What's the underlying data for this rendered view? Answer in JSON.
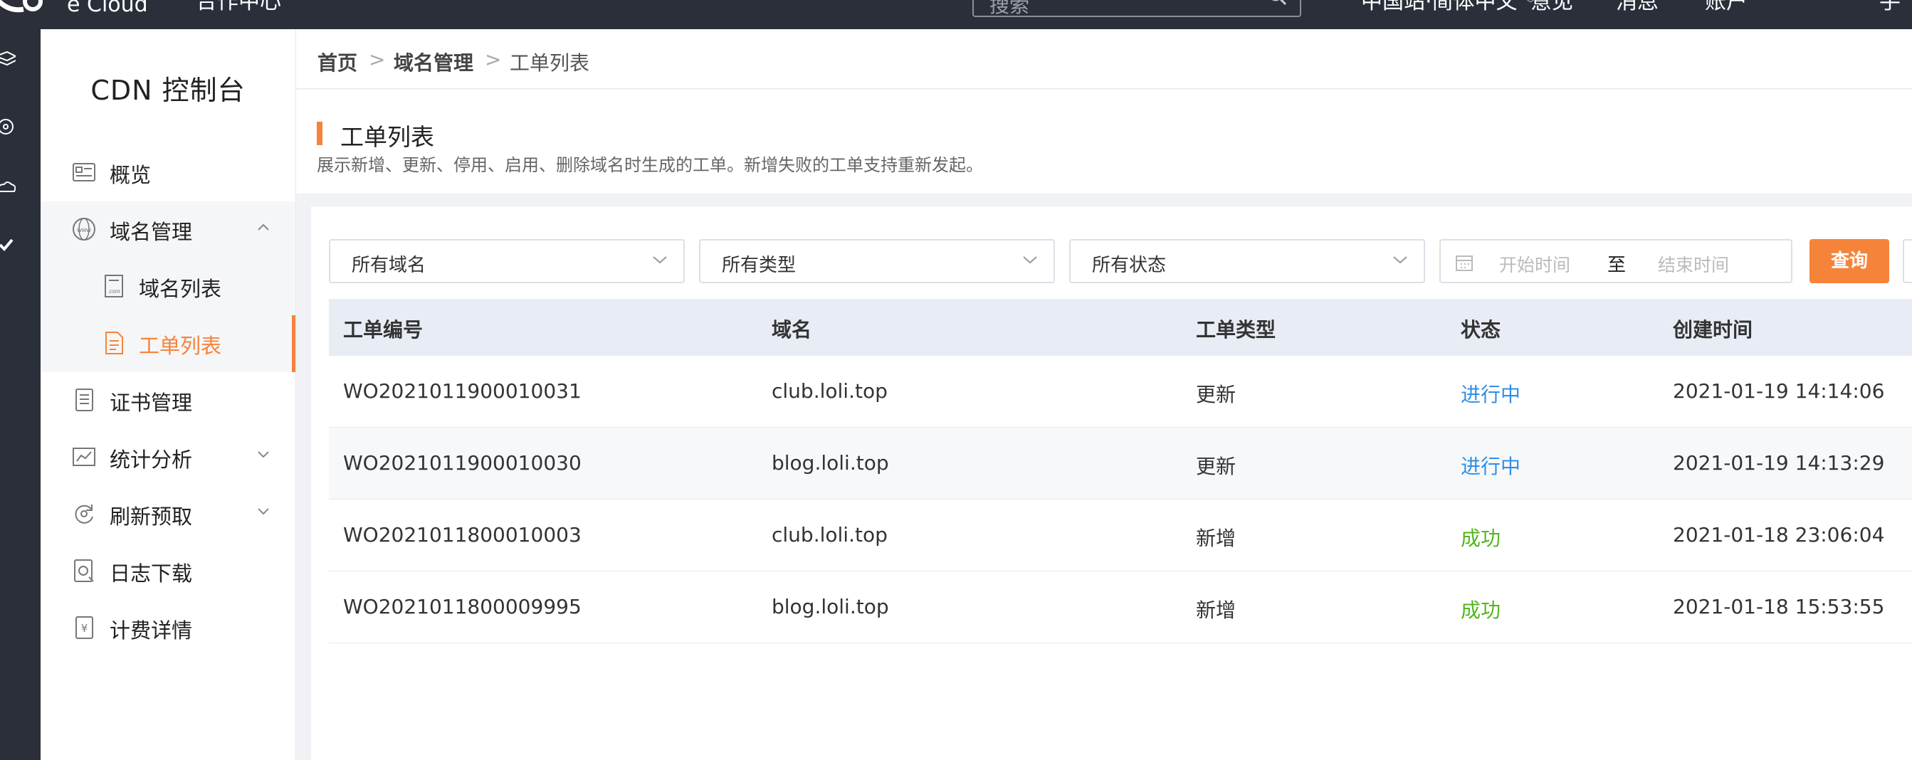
{
  "topbar": {
    "logo_text": "e Cloud",
    "nav_item": "合作中心",
    "search_placeholder": "搜索",
    "region_label": "中国站·简体中文",
    "links": [
      "意见",
      "消息",
      "账户",
      "手"
    ]
  },
  "sidebar": {
    "title": "CDN 控制台",
    "items": [
      {
        "label": "概览"
      },
      {
        "label": "域名管理"
      },
      {
        "label": "域名列表"
      },
      {
        "label": "工单列表"
      },
      {
        "label": "证书管理"
      },
      {
        "label": "统计分析"
      },
      {
        "label": "刷新预取"
      },
      {
        "label": "日志下载"
      },
      {
        "label": "计费详情"
      }
    ]
  },
  "breadcrumb": {
    "home": "首页",
    "separator": ">",
    "domain": "域名管理",
    "current": "工单列表"
  },
  "page": {
    "title": "工单列表",
    "description": "展示新增、更新、停用、启用、删除域名时生成的工单。新增失败的工单支持重新发起。"
  },
  "filters": {
    "domain": "所有域名",
    "type": "所有类型",
    "status": "所有状态",
    "start_placeholder": "开始时间",
    "range_separator": "至",
    "end_placeholder": "结束时间",
    "query_button": "查询"
  },
  "table": {
    "columns": [
      "工单编号",
      "域名",
      "工单类型",
      "状态",
      "创建时间"
    ],
    "rows": [
      {
        "id": "WO2021011900010031",
        "domain": "club.loli.top",
        "type": "更新",
        "status": "进行中",
        "created": "2021-01-19 14:14:06"
      },
      {
        "id": "WO2021011900010030",
        "domain": "blog.loli.top",
        "type": "更新",
        "status": "进行中",
        "created": "2021-01-19 14:13:29"
      },
      {
        "id": "WO2021011800010003",
        "domain": "club.loli.top",
        "type": "新增",
        "status": "成功",
        "created": "2021-01-18 23:06:04"
      },
      {
        "id": "WO2021011800009995",
        "domain": "blog.loli.top",
        "type": "新增",
        "status": "成功",
        "created": "2021-01-18 15:53:55"
      }
    ]
  },
  "colors": {
    "accent": "#f5843a",
    "status_in_progress": "#2f8fe6",
    "status_success": "#52b61c",
    "topbar_bg": "#2b2f3a"
  }
}
